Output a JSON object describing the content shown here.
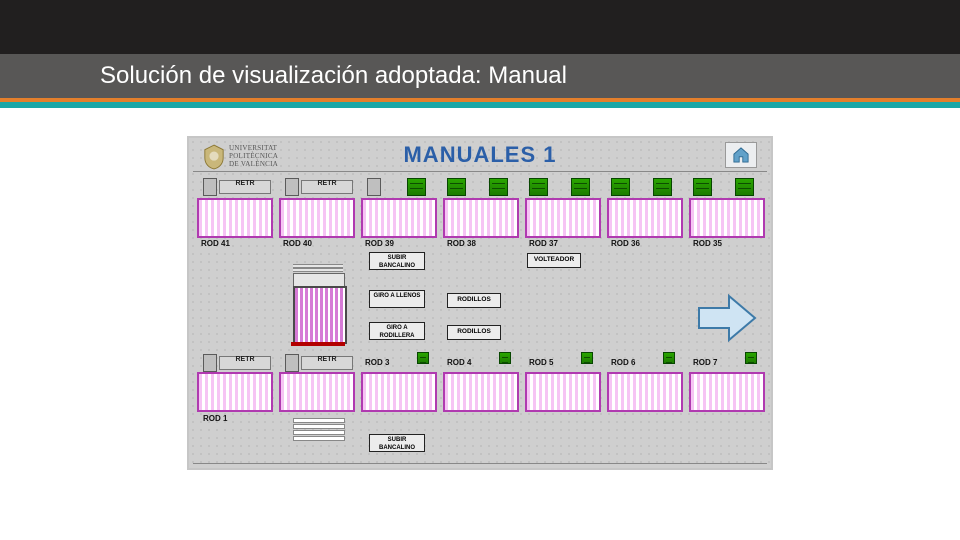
{
  "slide_title": "Solución de visualización adoptada: Manual",
  "hmi": {
    "logo_text": "UNIVERSITAT\nPOLITÈCNICA\nDE VALÈNCIA",
    "title": "MANUALES 1",
    "home": "home",
    "top_rods": [
      "ROD 41",
      "ROD 40",
      "ROD 39",
      "ROD 38",
      "ROD 37",
      "ROD 36",
      "ROD 35"
    ],
    "bottom_rods_left": "ROD 1",
    "bottom_rods_right": [
      "ROD 3",
      "ROD 4",
      "ROD 5",
      "ROD 6",
      "ROD 7"
    ],
    "retr": "RETR",
    "btn_subir": "SUBIR BANCALINO",
    "btn_giro_llenos": "GIRO A LLENOS",
    "btn_giro_rod": "GIRO A RODILLERA",
    "btn_volteador": "VOLTEADOR",
    "btn_rodillos": "RODILLOS"
  }
}
